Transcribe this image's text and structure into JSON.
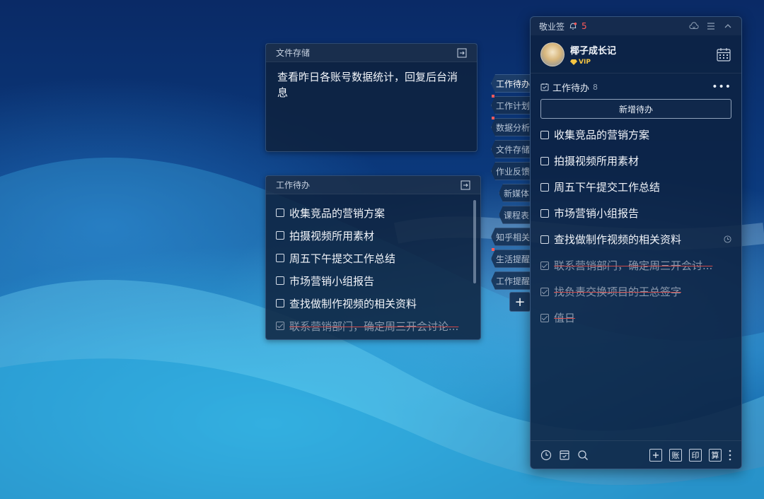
{
  "notes": {
    "file_card": {
      "title": "文件存储",
      "content": "查看昨日各账号数据统计，回复后台消息"
    },
    "todo_card": {
      "title": "工作待办",
      "items": [
        {
          "text": "收集竞品的营销方案",
          "done": false
        },
        {
          "text": "拍摄视频所用素材",
          "done": false
        },
        {
          "text": "周五下午提交工作总结",
          "done": false
        },
        {
          "text": "市场营销小组报告",
          "done": false
        },
        {
          "text": "查找做制作视频的相关资料",
          "done": false
        },
        {
          "text": "联系营销部门，确定周三开会讨论...",
          "done": true
        }
      ]
    }
  },
  "tabs": [
    {
      "label": "工作待办",
      "active": true,
      "dot": false
    },
    {
      "label": "工作计划",
      "active": false,
      "dot": true
    },
    {
      "label": "数据分析",
      "active": false,
      "dot": true
    },
    {
      "label": "文件存储",
      "active": false,
      "dot": false
    },
    {
      "label": "作业反馈",
      "active": false,
      "dot": false
    },
    {
      "label": "新媒体",
      "active": false,
      "dot": false
    },
    {
      "label": "课程表",
      "active": false,
      "dot": false
    },
    {
      "label": "知乎相关",
      "active": false,
      "dot": false
    },
    {
      "label": "生活提醒",
      "active": false,
      "dot": true
    },
    {
      "label": "工作提醒",
      "active": false,
      "dot": false
    }
  ],
  "add_tab_label": "+",
  "panel": {
    "app_name": "敬业签",
    "notification_count": "5",
    "user": {
      "name": "椰子成长记",
      "vip": "VIP"
    },
    "section": {
      "title": "工作待办",
      "count": "8",
      "more": "•••"
    },
    "new_button": "新增待办",
    "items": [
      {
        "text": "收集竞品的营销方案",
        "done": false
      },
      {
        "text": "拍摄视频所用素材",
        "done": false
      },
      {
        "text": "周五下午提交工作总结",
        "done": false
      },
      {
        "text": "市场营销小组报告",
        "done": false
      },
      {
        "text": "查找做制作视频的相关资料",
        "done": false,
        "reminder": true
      },
      {
        "text": "联系营销部门，确定周三开会讨...",
        "done": true
      },
      {
        "text": "找负责交换项目的王总签字",
        "done": true
      },
      {
        "text": "值日",
        "done": true
      }
    ],
    "footer": {
      "k1": "账",
      "k2": "印",
      "k3": "算"
    }
  },
  "colors": {
    "accent_red": "#ff5a5a",
    "vip_gold": "#f5c542"
  }
}
